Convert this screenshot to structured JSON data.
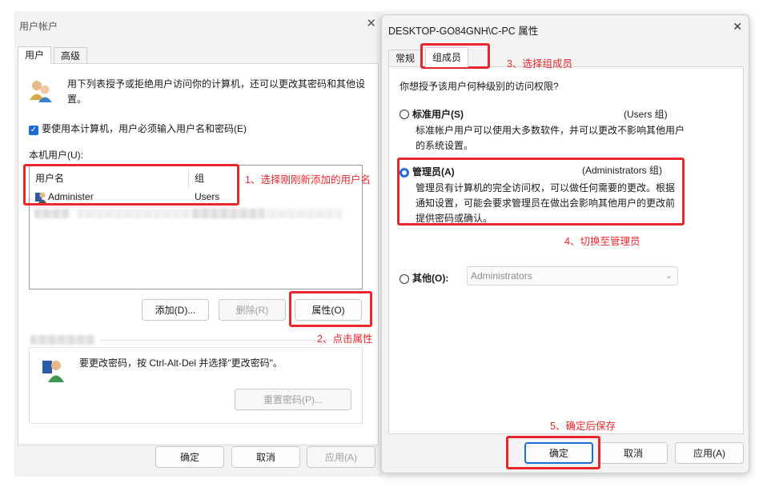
{
  "left_window": {
    "title": "用户帐户",
    "tabs": [
      "用户",
      "高级"
    ],
    "intro": "用下列表授予或拒绝用户访问你的计算机，还可以更改其密码和其他设置。",
    "must_login_label": "要使用本计算机，用户必须输入用户名和密码(E)",
    "must_login_checked": true,
    "local_users_label": "本机用户(U):",
    "columns": [
      "用户名",
      "组"
    ],
    "rows": [
      {
        "name": "Administer",
        "group": "Users"
      }
    ],
    "buttons": {
      "add": "添加(D)...",
      "remove": "删除(R)",
      "properties": "属性(O)"
    },
    "password_text": "要更改密码，按 Ctrl-Alt-Del 并选择\"更改密码\"。",
    "reset_password": "重置密码(P)...",
    "footer": {
      "ok": "确定",
      "cancel": "取消",
      "apply": "应用(A)"
    }
  },
  "right_window": {
    "title": "DESKTOP-GO84GNH\\C-PC 属性",
    "tabs": [
      "常规",
      "组成员"
    ],
    "question": "你想授予该用户何种级别的访问权限?",
    "options": [
      {
        "label": "标准用户(S)",
        "group": "(Users 组)",
        "desc": "标准帐户用户可以使用大多数软件，并可以更改不影响其他用户的系统设置。",
        "selected": false
      },
      {
        "label": "管理员(A)",
        "group": "(Administrators 组)",
        "desc": "管理员有计算机的完全访问权，可以做任何需要的更改。根据通知设置，可能会要求管理员在做出会影响其他用户的更改前提供密码或确认。",
        "selected": true
      },
      {
        "label": "其他(O):",
        "group": "",
        "desc": "",
        "selected": false
      }
    ],
    "other_value": "Administrators",
    "footer": {
      "ok": "确定",
      "cancel": "取消",
      "apply": "应用(A)"
    }
  },
  "annotations": {
    "step1": "1、选择刚刚新添加的用户名",
    "step2": "2、点击属性",
    "step3": "3、选择组成员",
    "step4": "4、切换至管理员",
    "step5": "5、确定后保存"
  },
  "colors": {
    "annotation": "#e8282d",
    "accent": "#1a6ed6"
  }
}
